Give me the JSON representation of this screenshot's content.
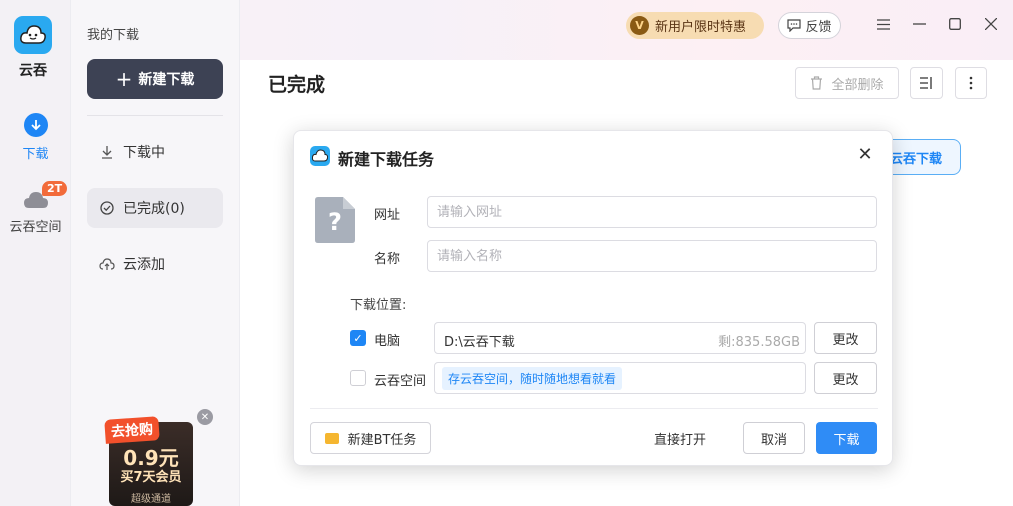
{
  "app": {
    "name": "云吞"
  },
  "rail": {
    "download_label": "下载",
    "cloud_label": "云吞空间",
    "cloud_badge": "2T"
  },
  "sidebar": {
    "title": "我的下载",
    "new_download": "新建下载",
    "items": [
      {
        "label": "下载中"
      },
      {
        "label": "已完成(0)"
      },
      {
        "label": "云添加"
      }
    ]
  },
  "promo": {
    "tag": "去抢购",
    "price": "0.9元",
    "desc": "买7天会员",
    "foot": "超级通道"
  },
  "header": {
    "title": "已完成",
    "vip_offer": "新用户限时特惠",
    "vip_badge": "V",
    "feedback": "反馈",
    "delete_all": "全部删除",
    "behind_button": "云吞下载"
  },
  "dialog": {
    "title": "新建下载任务",
    "url_label": "网址",
    "url_placeholder": "请输入网址",
    "url_value": "",
    "name_label": "名称",
    "name_placeholder": "请输入名称",
    "name_value": "",
    "location_title": "下载位置:",
    "pc_label": "电脑",
    "pc_path": "D:\\云吞下载",
    "pc_free": "剩:835.58GB",
    "cloud_label": "云吞空间",
    "cloud_hint": "存云吞空间，随时随地想看就看",
    "change_label": "更改",
    "bt_label": "新建BT任务",
    "open_label": "直接打开",
    "cancel_label": "取消",
    "download_label": "下载"
  },
  "colors": {
    "accent": "#2f8cf6",
    "dark_button": "#3d4254",
    "vip_bg": "#f7dcb2",
    "badge": "#f26b3a"
  }
}
